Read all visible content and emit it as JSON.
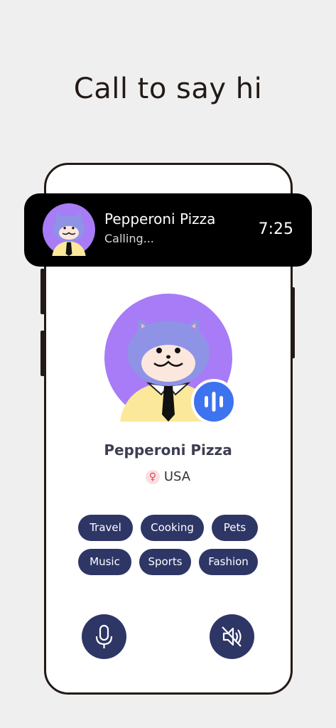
{
  "headline": "Call to say hi",
  "call": {
    "name": "Pepperoni Pizza",
    "status": "Calling...",
    "timer": "7:25"
  },
  "profile": {
    "name": "Pepperoni Pizza",
    "gender_icon": "female-symbol-icon",
    "country": "USA"
  },
  "interests": [
    "Travel",
    "Cooking",
    "Pets",
    "Music",
    "Sports",
    "Fashion"
  ],
  "controls": {
    "mic_icon": "microphone-icon",
    "speaker_icon": "speaker-muted-icon"
  },
  "colors": {
    "background": "#efefef",
    "avatar_circle": "#a87bf7",
    "accent_blue": "#3e73f0",
    "tag_navy": "#2e3666",
    "call_bar": "#000000"
  }
}
